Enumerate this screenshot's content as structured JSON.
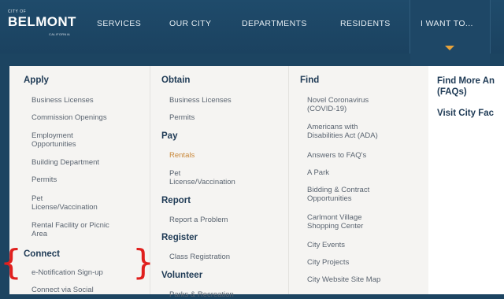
{
  "logo": {
    "city_of": "CITY OF",
    "name": "BELMONT",
    "state": "CALIFORNIA"
  },
  "nav": {
    "items": [
      "SERVICES",
      "OUR CITY",
      "DEPARTMENTS",
      "RESIDENTS",
      "I WANT TO..."
    ]
  },
  "menu": {
    "col1": {
      "apply_title": "Apply",
      "apply_links": [
        "Business Licenses",
        "Commission Openings",
        "Employment\nOpportunities",
        "Building Department",
        "Permits",
        "Pet\nLicense/Vaccination",
        "Rental Facility or Picnic\nArea"
      ],
      "connect_title": "Connect",
      "connect_links": [
        "e-Notification Sign-up",
        "Connect via Social"
      ]
    },
    "col2": {
      "obtain_title": "Obtain",
      "obtain_links": [
        "Business Licenses",
        "Permits"
      ],
      "pay_title": "Pay",
      "pay_links": [
        "Rentals",
        "Pet\nLicense/Vaccination"
      ],
      "report_title": "Report",
      "report_links": [
        "Report a Problem"
      ],
      "register_title": "Register",
      "register_links": [
        "Class Registration"
      ],
      "volunteer_title": "Volunteer",
      "volunteer_links": [
        "Parks & Recreation"
      ]
    },
    "col3": {
      "find_title": "Find",
      "find_links": [
        "Novel Coronavirus\n(COVID-19)",
        "Americans with\nDisabilities Act (ADA)",
        "Answers to FAQ's",
        "A Park",
        "Bidding & Contract\nOpportunities",
        "Carlmont Village\nShopping Center",
        "City Events",
        "City Projects",
        "City Website Site Map"
      ]
    },
    "col4": {
      "links": [
        "Find More An\n(FAQs)",
        "Visit City Fac"
      ]
    }
  },
  "colors": {
    "nav_bg": "#1c4461",
    "accent": "#e8a33a",
    "heading": "#1e3a55",
    "annotation": "#e0201e"
  }
}
